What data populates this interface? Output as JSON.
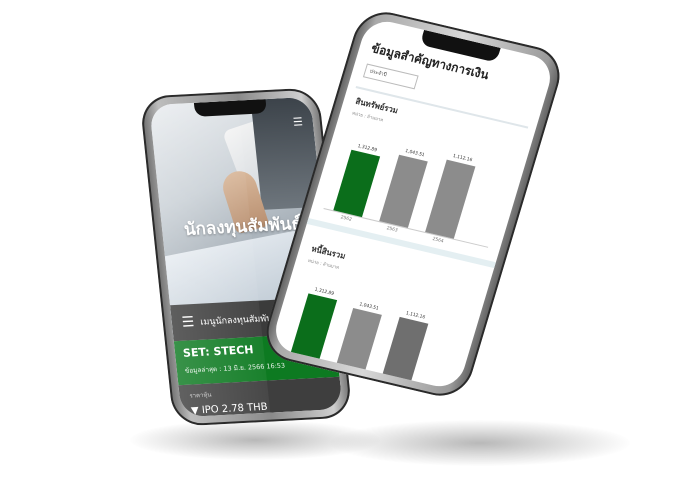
{
  "left_phone": {
    "hero_title": "นักลงทุนสัมพันธ์",
    "nav_label": "เมนูนักลงทุนสัมพันธ์",
    "set_symbol": "SET: STECH",
    "update_text": "ข้อมูลล่าสุด : 13 มิ.ย. 2566 16:53",
    "info_label": "ราคาหุ้น",
    "ipo_text": "IPO 2.78 THB"
  },
  "right_phone": {
    "title": "ข้อมูลสำคัญทางการเงิน",
    "dropdown_value": "ประจำปี",
    "charts": [
      {
        "title": "สินทรัพย์รวม",
        "unit": "หน่วย : ล้านบาท",
        "bars": [
          {
            "label": "1,312.89",
            "x": "2562",
            "value": 0.78,
            "color": "#0b6e1b"
          },
          {
            "label": "1,043.51",
            "x": "2563",
            "value": 0.85,
            "color": "#8c8c8c"
          },
          {
            "label": "1,112.16",
            "x": "2564",
            "value": 0.92,
            "color": "#8c8c8c"
          }
        ]
      },
      {
        "title": "หนี้สินรวม",
        "unit": "หน่วย : ล้านบาท",
        "bars": [
          {
            "label": "1,312.89",
            "x": "",
            "value": 0.82,
            "color": "#0b6e1b"
          },
          {
            "label": "1,043.51",
            "x": "",
            "value": 0.78,
            "color": "#8c8c8c"
          },
          {
            "label": "1,112.16",
            "x": "",
            "value": 0.8,
            "color": "#6f6f6f"
          }
        ]
      }
    ]
  }
}
